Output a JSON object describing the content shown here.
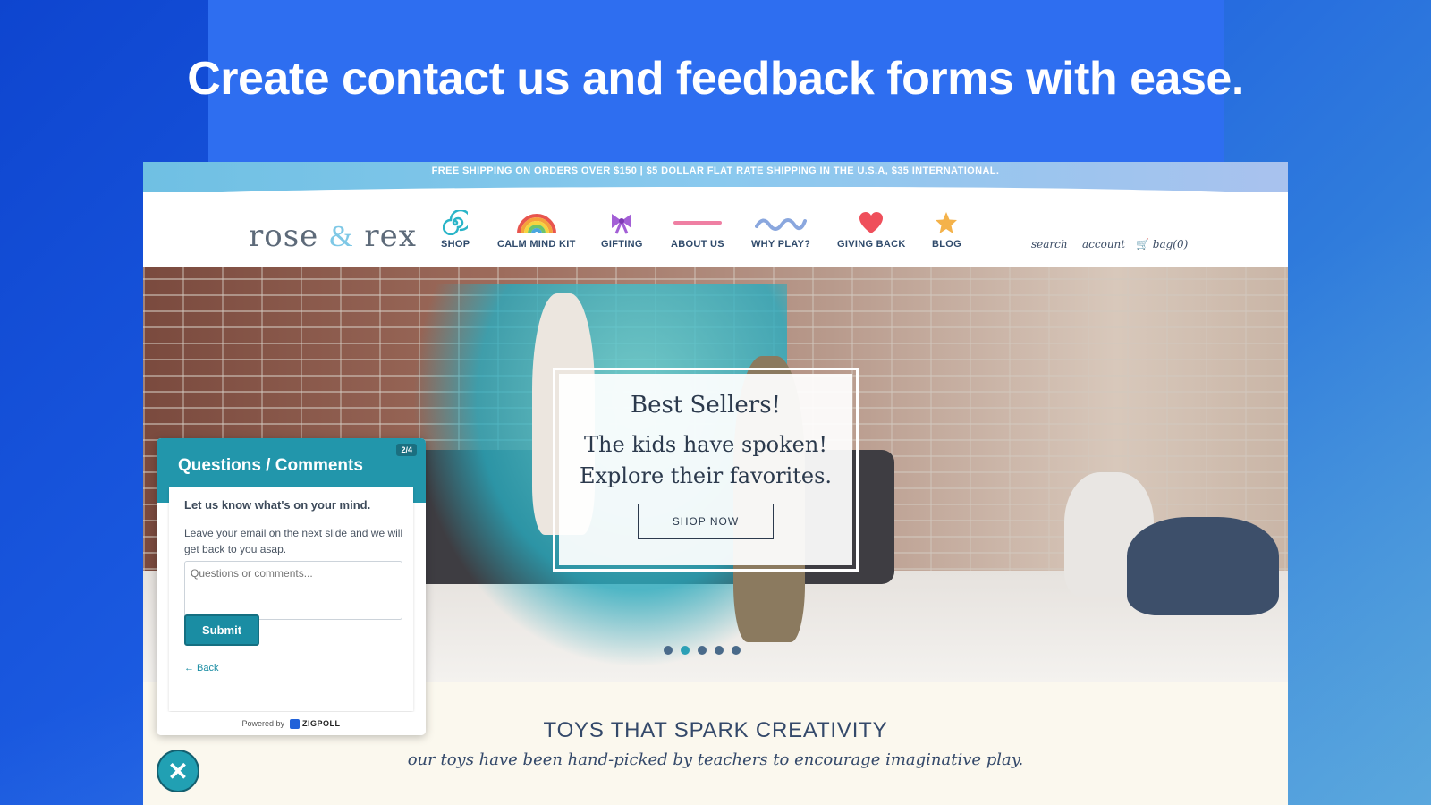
{
  "headline": "Create contact us and feedback forms with ease.",
  "site": {
    "shipping_bar": "FREE SHIPPING ON ORDERS OVER $150 | $5 DOLLAR FLAT RATE SHIPPING IN THE U.S.A, $35 INTERNATIONAL.",
    "logo": {
      "left": "rose",
      "amp": "&",
      "right": "rex"
    },
    "nav": [
      {
        "label": "SHOP",
        "icon": "swirl-icon"
      },
      {
        "label": "CALM MIND KIT",
        "icon": "rainbow-icon"
      },
      {
        "label": "GIFTING",
        "icon": "bow-icon"
      },
      {
        "label": "ABOUT US",
        "icon": "line-icon"
      },
      {
        "label": "WHY PLAY?",
        "icon": "wave-icon"
      },
      {
        "label": "GIVING BACK",
        "icon": "heart-icon"
      },
      {
        "label": "BLOG",
        "icon": "star-icon"
      }
    ],
    "utility": {
      "search": "search",
      "account": "account",
      "bag": "bag(0)"
    },
    "hero": {
      "heading": "Best Sellers!",
      "line1": "The kids have spoken!",
      "line2": "Explore their favorites.",
      "cta": "SHOP NOW",
      "slides": 5,
      "active_slide": 2
    },
    "section_title": "TOYS THAT SPARK CREATIVITY",
    "section_subtitle": "our toys have been hand-picked by teachers to encourage imaginative play."
  },
  "widget": {
    "title": "Questions / Comments",
    "step": "2/4",
    "question": "Let us know what's on your mind.",
    "description": "Leave your email on the next slide and we will get back to you asap.",
    "placeholder": "Questions or comments...",
    "submit": "Submit",
    "back": "← Back",
    "powered_by": "Powered by",
    "brand": "ZIGPOLL"
  },
  "close_label": "✕",
  "colors": {
    "accent": "#2296ab",
    "background": "#1d4fd0",
    "brand_blue": "#2162d9"
  }
}
